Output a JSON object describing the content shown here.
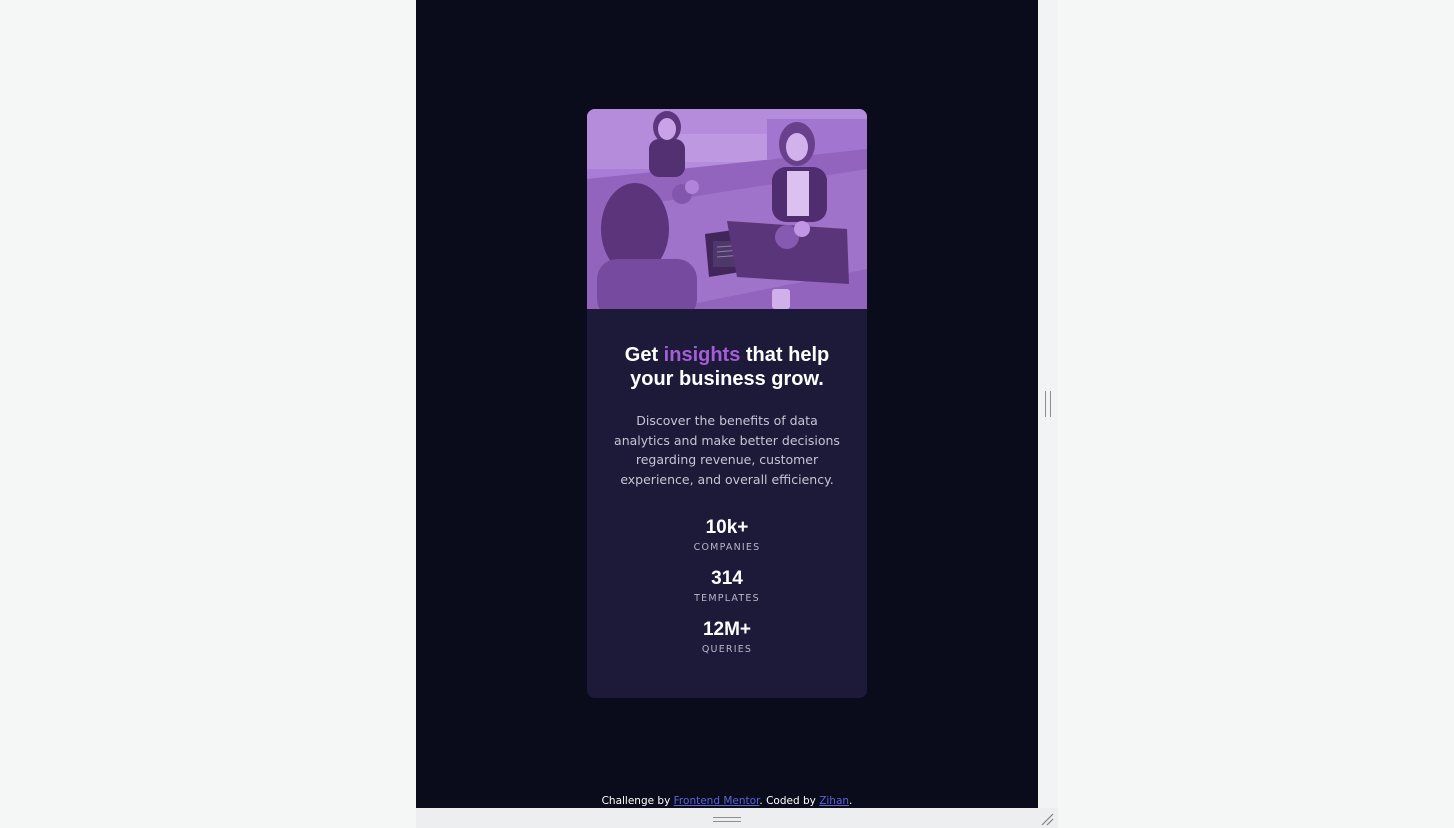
{
  "card": {
    "image_alt": "Team working around a table with laptops",
    "headline": {
      "part1": "Get ",
      "accent": "insights",
      "part2": " that help your business grow."
    },
    "description": "Discover the benefits of data analytics and make better decisions regarding revenue, customer experience, and overall efficiency.",
    "stats": [
      {
        "value": "10k+",
        "label": "COMPANIES"
      },
      {
        "value": "314",
        "label": "TEMPLATES"
      },
      {
        "value": "12M+",
        "label": "QUERIES"
      }
    ]
  },
  "attribution": {
    "prefix": "Challenge by ",
    "link1": "Frontend Mentor",
    "middle": ". Coded by ",
    "link2": "Zihan",
    "suffix": "."
  },
  "colors": {
    "page_bg": "#0a0c1b",
    "card_bg": "#1c1a38",
    "accent": "#a45ed6",
    "image_tint": "#a983d6",
    "link": "#5c64d6"
  }
}
